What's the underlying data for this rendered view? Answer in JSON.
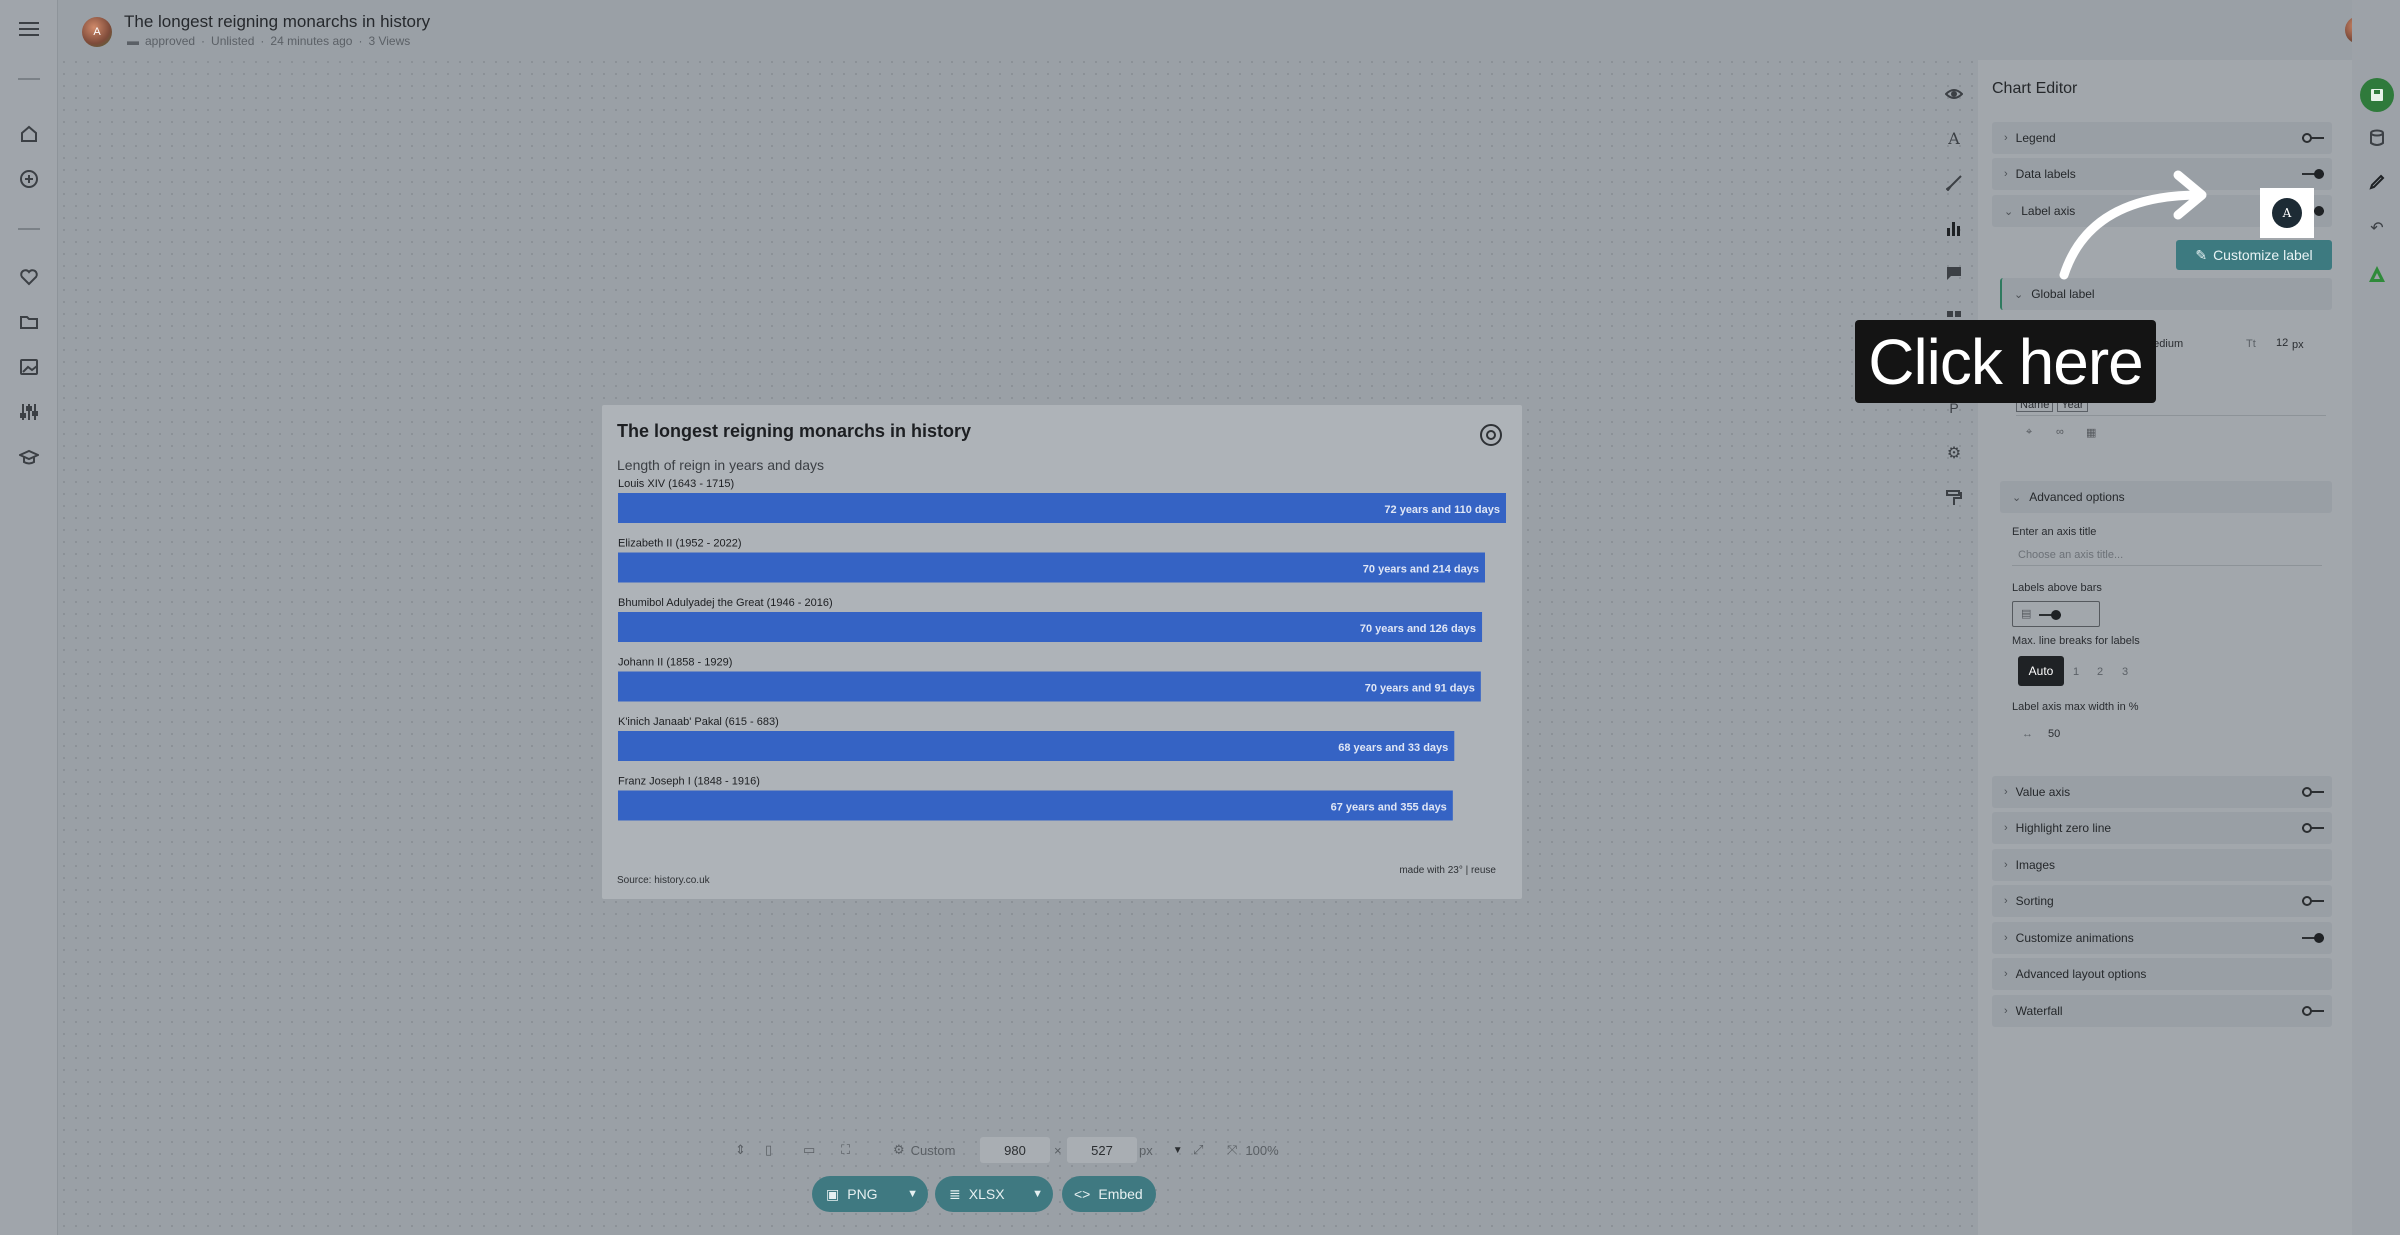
{
  "document": {
    "title": "The longest reigning monarchs in history",
    "status": "approved",
    "visibility": "Unlisted",
    "edited": "24 minutes ago",
    "views": "3 Views",
    "user_initial": "A"
  },
  "chart": {
    "title": "The longest reigning monarchs in history",
    "subtitle": "Length of reign in years and days",
    "source": "Source: history.co.uk",
    "credit": "made with 23° | reuse",
    "bar_color": "#3563c4"
  },
  "chart_data": {
    "type": "bar",
    "orientation": "horizontal",
    "title": "The longest reigning monarchs in history",
    "subtitle": "Length of reign in years and days",
    "categories": [
      "Louis XIV (1643 - 1715)",
      "Elizabeth II (1952 - 2022)",
      "Bhumibol Adulyadej the Great (1946 - 2016)",
      "Johann II (1858 - 1929)",
      "K'inich Janaab' Pakal (615 - 683)",
      "Franz Joseph I (1848 - 1916)"
    ],
    "values": [
      72.3,
      70.59,
      70.35,
      70.25,
      68.09,
      67.97
    ],
    "data_labels": [
      "72 years and 110 days",
      "70 years and 214 days",
      "70 years and 126 days",
      "70 years and 91 days",
      "68 years and 33 days",
      "67 years and 355 days"
    ],
    "legend": "none",
    "grid": false
  },
  "size_bar": {
    "preset": "Custom",
    "width": "980",
    "times": "×",
    "height": "527",
    "unit": "px",
    "zoom": "100%"
  },
  "export": {
    "png": "PNG",
    "xlsx": "XLSX",
    "embed": "Embed"
  },
  "editor": {
    "title": "Chart Editor",
    "sections": {
      "legend": "Legend",
      "data_labels": "Data labels",
      "label_axis": "Label axis",
      "global_label": "Global label",
      "advanced_options": "Advanced options",
      "value_axis": "Value axis",
      "highlight_zero": "Highlight zero line",
      "images": "Images",
      "sorting": "Sorting",
      "animations": "Customize animations",
      "advanced_layout": "Advanced layout options",
      "waterfall": "Waterfall"
    },
    "font_weight": "Medium",
    "font_size": "12",
    "font_size_unit": "px",
    "label_tokens": [
      "Name",
      "Year"
    ],
    "axis_title_label": "Enter an axis title",
    "axis_title_placeholder": "Choose an axis title...",
    "labels_above_bars": "Labels above bars",
    "max_line_breaks": "Max. line breaks for labels",
    "line_break_options": [
      "Auto",
      "1",
      "2",
      "3"
    ],
    "max_width_label": "Label axis max width in %",
    "max_width_value": "50"
  },
  "overlay": {
    "click_here": "Click here",
    "customize_label": "Customize label",
    "avatar_letter": "A"
  }
}
